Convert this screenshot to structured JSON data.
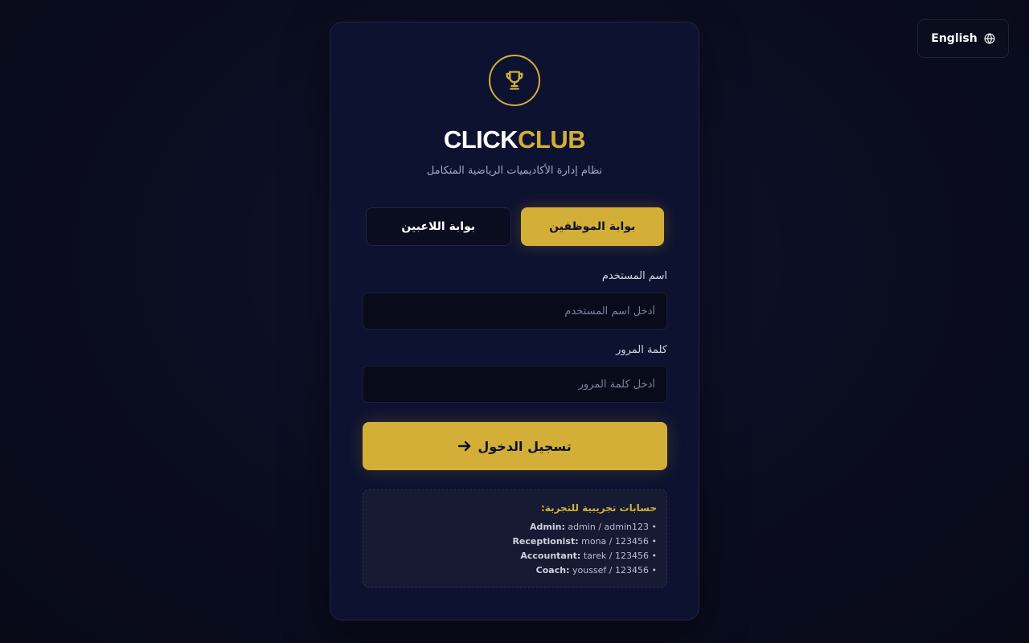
{
  "language_switch": {
    "label": "English",
    "icon": "globe-icon"
  },
  "brand": {
    "icon": "trophy-icon",
    "name_part1": "CLICK",
    "name_part2": "CLUB",
    "subtitle": "نظام إدارة الأكاديميات الرياضية المتكامل"
  },
  "tabs": [
    {
      "label": "بوابة الموظفين",
      "active": true
    },
    {
      "label": "بوابة اللاعبين",
      "active": false
    }
  ],
  "form": {
    "username_label": "اسم المستخدم",
    "username_placeholder": "أدخل اسم المستخدم",
    "username_value": "",
    "password_label": "كلمة المرور",
    "password_placeholder": "أدخل كلمة المرور",
    "password_value": "",
    "submit_label": "تسجيل الدخول",
    "submit_icon": "arrow-icon"
  },
  "demo_accounts": {
    "title": "حسابات تجريبية للتجربة:",
    "accounts": [
      {
        "role": "Admin:",
        "credentials": "admin / admin123"
      },
      {
        "role": "Receptionist:",
        "credentials": "mona / 123456"
      },
      {
        "role": "Accountant:",
        "credentials": "tarek / 123456"
      },
      {
        "role": "Coach:",
        "credentials": "youssef / 123456"
      }
    ]
  },
  "colors": {
    "accent": "#d4af37",
    "background": "#0a0d1f",
    "card": "#0d1230"
  }
}
